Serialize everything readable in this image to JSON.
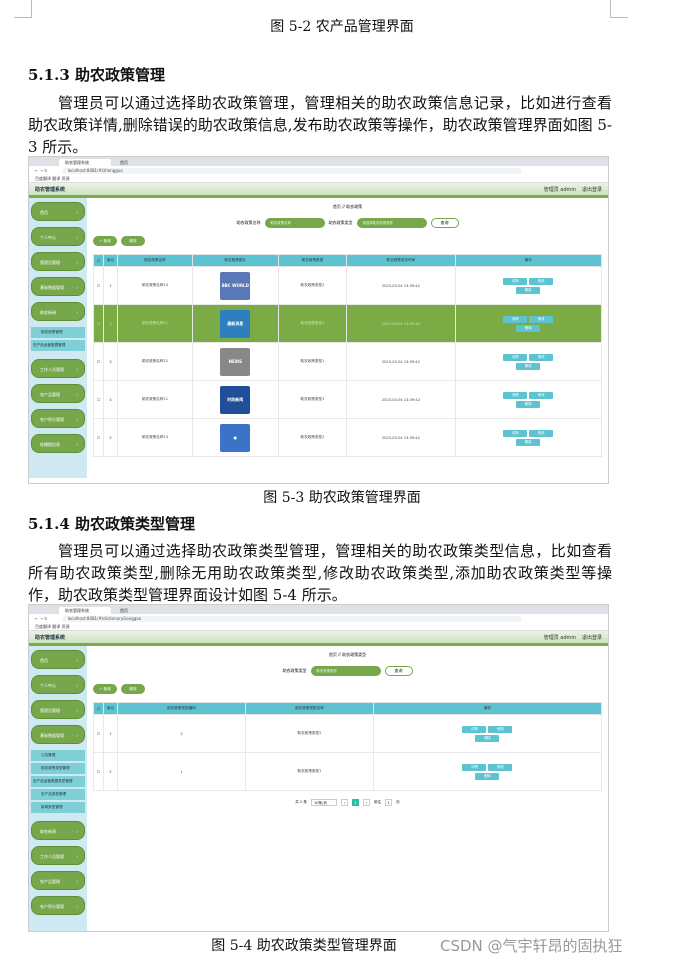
{
  "doc": {
    "caption_52": "图 5-2 农产品管理界面",
    "h_513": "5.1.3 助农政策管理",
    "p_513": "管理员可以通过选择助农政策管理，管理相关的助农政策信息记录，比如进行查看助农政策详情,删除错误的助农政策信息,发布助农政策等操作，助农政策管理界面如图 5-3 所示。",
    "caption_53": "图 5-3  助农政策管理界面",
    "h_514": "5.1.4 助农政策类型管理",
    "p_514": "管理员可以通过选择助农政策类型管理，管理相关的助农政策类型信息，比如查看所有助农政策类型,删除无用助农政策类型,修改助农政策类型,添加助农政策类型等操作，助农政策类型管理界面设计如图 5-4 所示。",
    "caption_54": "图 5-4 助农政策类型管理界面",
    "watermark": "CSDN @气宇轩昂的固执狂"
  },
  "browser": {
    "tab1": "助农管理系统",
    "tab2": "首页",
    "bookmarks": "百度翻译   翻译   资源",
    "url1": "localhost:8081/#/zhongguo",
    "url2": "localhost:8081/#/dictionaryGonggao"
  },
  "app": {
    "title": "助农管理系统",
    "admin": "管理员 admin",
    "logout": "退出登录"
  },
  "shot1": {
    "menu": [
      "首页",
      "个人中心",
      "管理员管理",
      "基础数据管理",
      "助农新闻"
    ],
    "sub": [
      "助农政策管理",
      "农产品运营数据管理"
    ],
    "menu2": [
      "工作人员管理",
      "农产品管理",
      "农户积分管理",
      "轮播图信息"
    ],
    "crumb": "首页  //  助农政策",
    "search_label1": "助农政策名称",
    "search_ph1": "助农政策名称",
    "search_label2": "助农政策类型",
    "search_ph2": "请选择助农政策类型",
    "search_btn": "查询",
    "add_btn": "+ 新增",
    "del_btn": "删除",
    "headers": [
      "索引",
      "助农政策名称",
      "助农政策图片",
      "助农政策类型",
      "助农政策发布时间",
      "操作"
    ],
    "rows": [
      {
        "idx": "1",
        "name": "助农政策名称14",
        "type": "助农政策类型2",
        "time": "2023-03-04 13:39:42",
        "img": "BBC WORLD NEWS",
        "color": "#5a78b8"
      },
      {
        "idx": "2",
        "name": "助农政策名称11",
        "type": "助农政策类型1",
        "time": "2023-03-04 13:39:42",
        "img": "最新消息",
        "color": "#2f7fc0"
      },
      {
        "idx": "3",
        "name": "助农政策名称12",
        "type": "助农政策类型1",
        "time": "2023-03-04 13:39:42",
        "img": "NEWS",
        "color": "#888"
      },
      {
        "idx": "4",
        "name": "助农政策名称11",
        "type": "助农政策类型1",
        "time": "2023-03-04 13:39:42",
        "img": "时政新闻",
        "color": "#1f4f99"
      },
      {
        "idx": "5",
        "name": "助农政策名称13",
        "type": "助农政策类型2",
        "time": "2023-03-04 13:39:42",
        "img": "●",
        "color": "#3a73c8"
      }
    ],
    "op_detail": "详情",
    "op_edit": "修改",
    "op_delete": "删除"
  },
  "shot2": {
    "menu": [
      "首页",
      "个人中心",
      "管理员管理",
      "基础数据管理"
    ],
    "sub": [
      "公告管理",
      "助农政策类型管理",
      "农产品运营数据类型管理",
      "农产品类型管理",
      "新闻类型管理"
    ],
    "menu2": [
      "助农新闻",
      "工作人员管理",
      "农产品管理",
      "农户积分管理"
    ],
    "crumb": "首页  //  助农政策类型",
    "search_label": "助农政策类型",
    "search_ph": "助农政策类型",
    "search_btn": "查询",
    "add_btn": "+ 新增",
    "del_btn": "删除",
    "headers": [
      "索引",
      "助农政策类型编码",
      "助农政策类型名称",
      "操作"
    ],
    "rows": [
      {
        "idx": "1",
        "code": "2",
        "name": "助农政策类型2"
      },
      {
        "idx": "2",
        "code": "1",
        "name": "助农政策类型1"
      }
    ],
    "op_detail": "详情",
    "op_edit": "修改",
    "op_delete": "删除",
    "pager_total": "共 2 条",
    "pager_size": "10条/页",
    "pager_page": "1",
    "pager_goto": "前往",
    "pager_goto_val": "1",
    "pager_unit": "页"
  }
}
